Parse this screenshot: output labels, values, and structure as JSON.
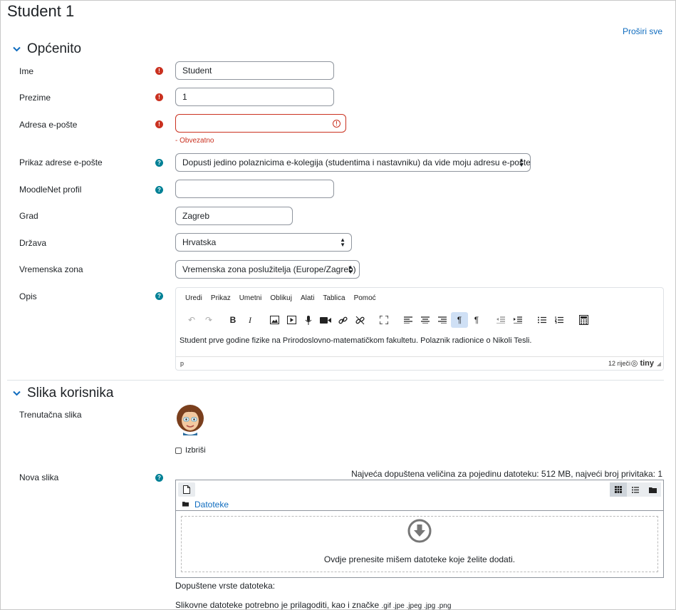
{
  "page": {
    "title": "Student 1",
    "expand_all": "Proširi sve"
  },
  "sections": {
    "general": {
      "title": "Općenito"
    },
    "picture": {
      "title": "Slika korisnika"
    }
  },
  "fields": {
    "firstname": {
      "label": "Ime",
      "value": "Student"
    },
    "lastname": {
      "label": "Prezime",
      "value": "1"
    },
    "email": {
      "label": "Adresa e-pošte",
      "value": "",
      "error": "- Obvezatno"
    },
    "email_display": {
      "label": "Prikaz adrese e-pošte",
      "value": "Dopusti jedino polaznicima e-kolegija (studentima i nastavniku) da vide moju adresu e-pošte."
    },
    "moodlenet": {
      "label": "MoodleNet profil",
      "value": ""
    },
    "city": {
      "label": "Grad",
      "value": "Zagreb"
    },
    "country": {
      "label": "Država",
      "value": "Hrvatska"
    },
    "timezone": {
      "label": "Vremenska zona",
      "value": "Vremenska zona poslužitelja (Europe/Zagreb)"
    },
    "description": {
      "label": "Opis"
    }
  },
  "editor": {
    "menus": [
      "Uredi",
      "Prikaz",
      "Umetni",
      "Oblikuj",
      "Alati",
      "Tablica",
      "Pomoć"
    ],
    "content": "Student prve godine fizike na Prirodoslovno-matematičkom fakultetu. Polaznik radionice o Nikoli Tesli.",
    "path": "p",
    "word_count": "12 riječi",
    "brand": "tiny"
  },
  "picture": {
    "current_label": "Trenutačna slika",
    "delete_label": "Izbriši",
    "new_label": "Nova slika",
    "limits": "Najveća dopuštena veličina za pojedinu datoteku: 512 MB, najveći broj privitaka: 1",
    "folder": "Datoteke",
    "drop_text": "Ovdje prenesite mišem datoteke koje želite dodati.",
    "types_label": "Dopuštene vrste datoteka:",
    "types_desc": "Slikovne datoteke potrebno je prilagoditi, kao i značke",
    "types_ext": ".gif .jpe .jpeg .jpg .png"
  },
  "colors": {
    "accent": "#0f6cbf",
    "required": "#ca3120",
    "help": "#008196"
  }
}
